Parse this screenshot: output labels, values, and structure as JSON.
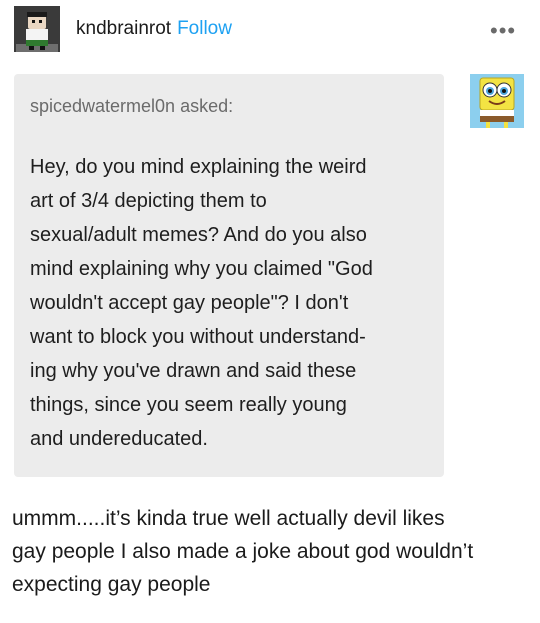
{
  "header": {
    "username": "kndbrainrot",
    "follow_label": "Follow",
    "more_icon": "•••"
  },
  "ask": {
    "asker": "spicedwatermel0n",
    "asked_label": "asked:",
    "question_lines": [
      "Hey, do you mind explaining the weird",
      "art of 3/4 depicting them to",
      "sexual/adult memes? And do you also",
      "mind explaining why you claimed \"God",
      "wouldn't accept gay people\"? I don't",
      "want to block you without understand-",
      "ing why you've drawn and said these",
      "things, since you seem really young",
      "and undereducated."
    ]
  },
  "answer": {
    "lines": [
      "ummm.....it’s kinda true well actually devil likes",
      "gay people I also made a joke about god wouldn’t",
      "expecting gay people"
    ]
  },
  "colors": {
    "follow": "#1da1f2",
    "ask_background": "#ececec",
    "asker_text": "#6b6b6b"
  }
}
